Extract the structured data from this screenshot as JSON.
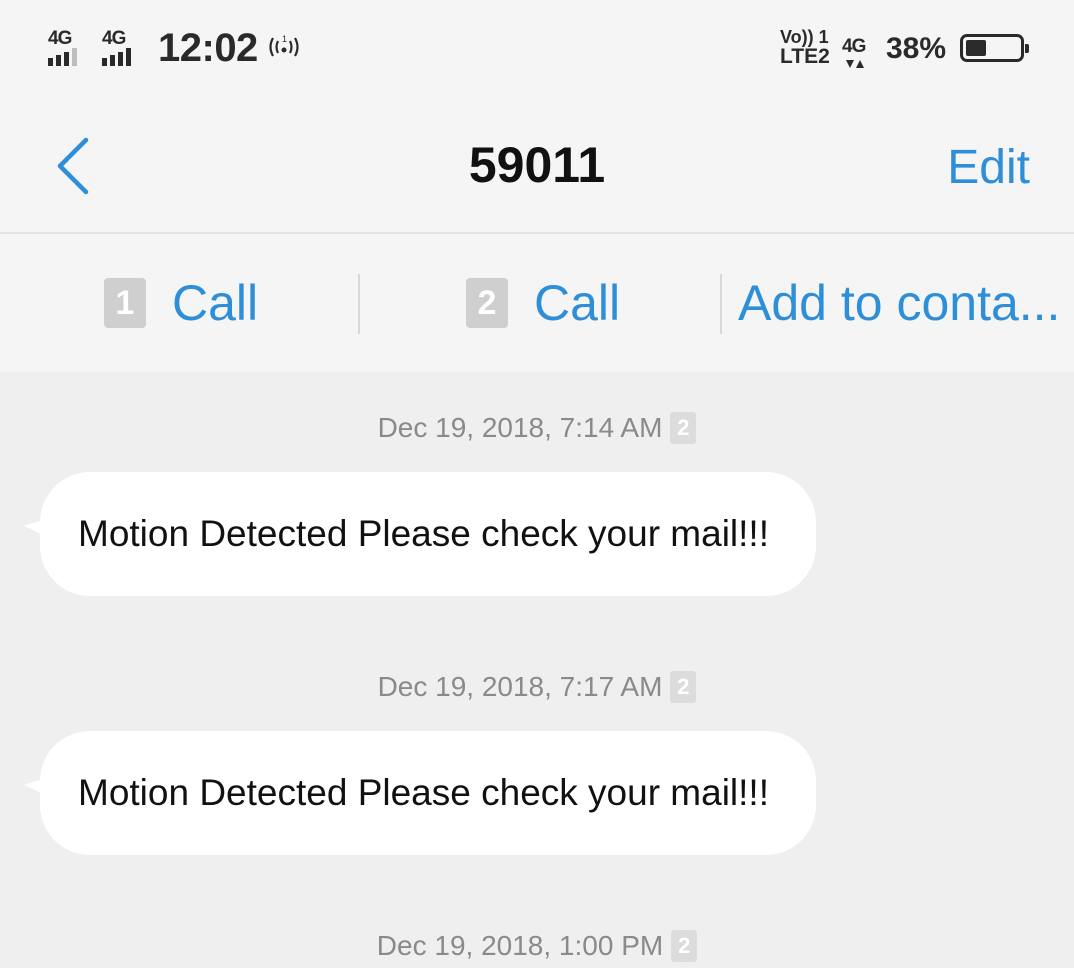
{
  "status_bar": {
    "sim1_network": "4G",
    "sim2_network": "4G",
    "time": "12:02",
    "hotspot_icon": "hotspot-icon",
    "volte_top": "Vo)) 1",
    "volte_bottom": "LTE2",
    "data_network": "4G",
    "battery_percent": "38%",
    "battery_level": 0.38
  },
  "header": {
    "back_icon": "chevron-left-icon",
    "title": "59011",
    "edit_label": "Edit"
  },
  "actions": {
    "call1_sim": "1",
    "call1_label": "Call",
    "call2_sim": "2",
    "call2_label": "Call",
    "add_contact_label": "Add to conta..."
  },
  "messages": [
    {
      "timestamp": "Dec 19, 2018, 7:14 AM",
      "sim": "2",
      "text": "Motion Detected Please check your mail!!!"
    },
    {
      "timestamp": "Dec 19, 2018, 7:17 AM",
      "sim": "2",
      "text": "Motion Detected Please check your mail!!!"
    },
    {
      "timestamp": "Dec 19, 2018, 1:00 PM",
      "sim": "2"
    }
  ],
  "colors": {
    "accent": "#2e8fd8",
    "background": "#efefef",
    "bar_background": "#f5f5f5",
    "bubble": "#ffffff"
  }
}
